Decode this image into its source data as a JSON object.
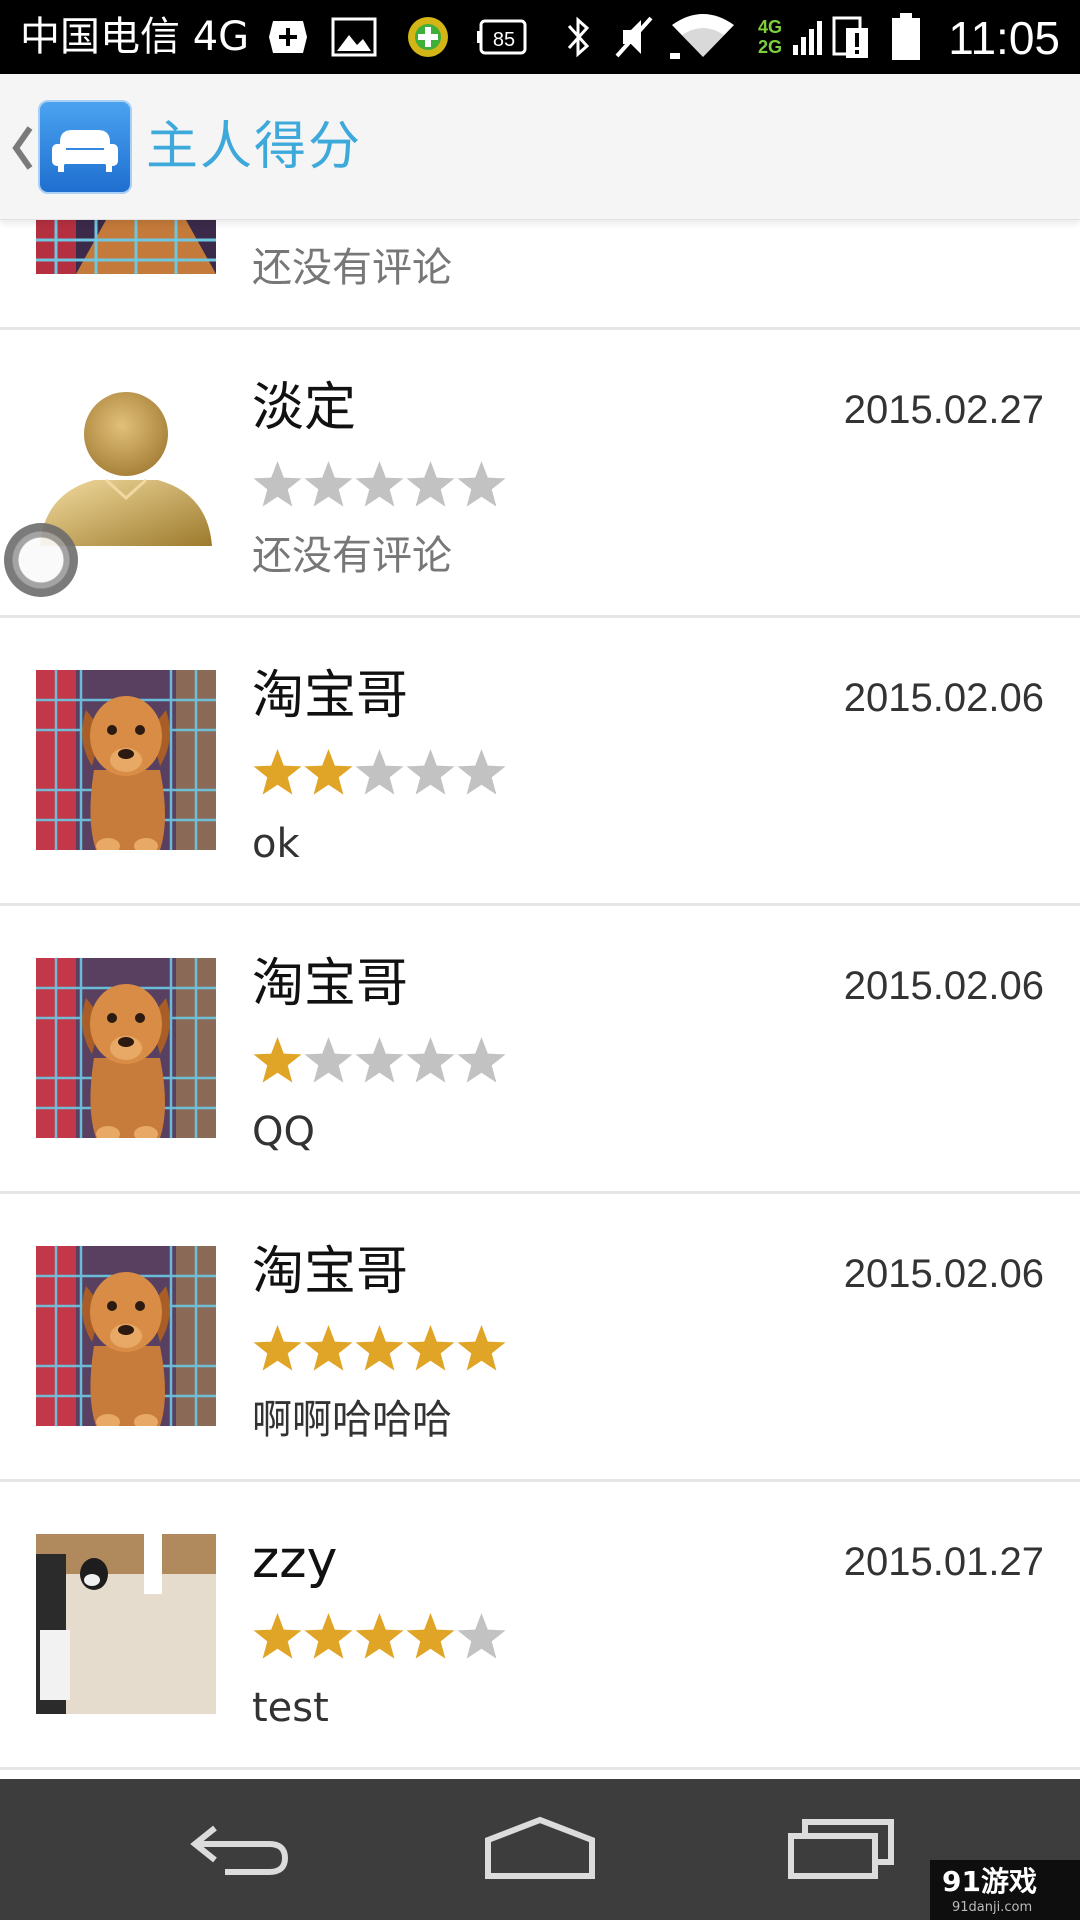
{
  "status_bar": {
    "carrier": "中国电信 4G",
    "battery_level_badge": "85",
    "network_badge_top": "4G",
    "network_badge_bottom": "2G",
    "time": "11:05"
  },
  "app_bar": {
    "title": "主人得分",
    "logo_icon": "sofa-icon",
    "back_icon": "back-caret-icon"
  },
  "colors": {
    "title_blue": "#3da9db",
    "star_filled": "#e0a526",
    "star_empty": "#c2c2c2",
    "navbar_bg": "#3d3d3d"
  },
  "partial_row": {
    "comment": "还没有评论"
  },
  "reviews": [
    {
      "name": "淡定",
      "date": "2015.02.27",
      "rating": 0,
      "max_rating": 5,
      "comment": "还没有评论",
      "avatar": "default-user-avatar-icon"
    },
    {
      "name": "淘宝哥",
      "date": "2015.02.06",
      "rating": 2,
      "max_rating": 5,
      "comment": "ok",
      "avatar": "puppy-photo"
    },
    {
      "name": "淘宝哥",
      "date": "2015.02.06",
      "rating": 1,
      "max_rating": 5,
      "comment": "QQ",
      "avatar": "puppy-photo"
    },
    {
      "name": "淘宝哥",
      "date": "2015.02.06",
      "rating": 5,
      "max_rating": 5,
      "comment": "啊啊哈哈哈",
      "avatar": "puppy-photo"
    },
    {
      "name": "zzy",
      "date": "2015.01.27",
      "rating": 4,
      "max_rating": 5,
      "comment": "test",
      "avatar": "room-photo"
    }
  ],
  "nav_bar": {
    "back": "back-arrow-icon",
    "home": "home-icon",
    "recents": "recent-apps-icon"
  },
  "watermark": {
    "main": "91游戏",
    "sub": "91danji.com"
  }
}
